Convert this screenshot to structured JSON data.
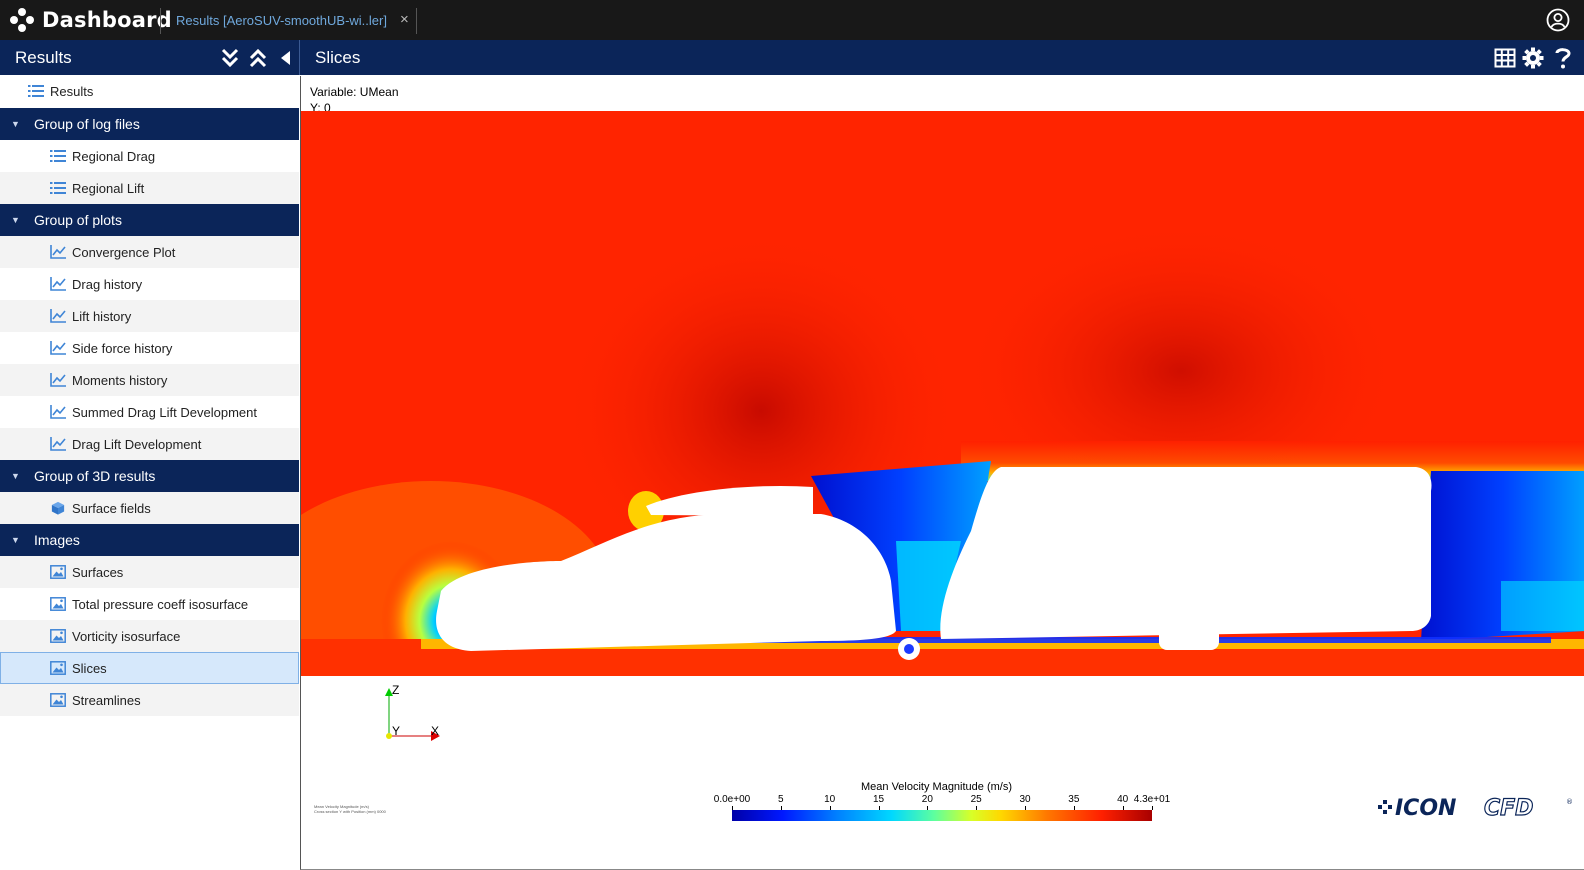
{
  "topbar": {
    "brand": "Dashboard",
    "tab_label": "Results [AeroSUV-smoothUB-wi..ler]",
    "tab_close": "×",
    "user_icon": "user-circle-icon"
  },
  "header": {
    "left_title": "Results",
    "main_title": "Slices",
    "left_icons": [
      "expand-all-icon",
      "collapse-all-icon",
      "collapse-panel-icon"
    ],
    "right_icons": [
      "table-icon",
      "gear-icon",
      "help-icon"
    ]
  },
  "sidebar": {
    "root": {
      "label": "Results",
      "icon": "list-icon"
    },
    "groups": [
      {
        "label": "Group of log files",
        "items": [
          {
            "label": "Regional Drag",
            "icon": "list-icon"
          },
          {
            "label": "Regional Lift",
            "icon": "list-icon"
          }
        ]
      },
      {
        "label": "Group of plots",
        "items": [
          {
            "label": "Convergence Plot",
            "icon": "line-chart-icon"
          },
          {
            "label": "Drag history",
            "icon": "line-chart-icon"
          },
          {
            "label": "Lift history",
            "icon": "line-chart-icon"
          },
          {
            "label": "Side force history",
            "icon": "line-chart-icon"
          },
          {
            "label": "Moments history",
            "icon": "line-chart-icon"
          },
          {
            "label": "Summed Drag Lift Development",
            "icon": "line-chart-icon"
          },
          {
            "label": "Drag Lift Development",
            "icon": "line-chart-icon"
          }
        ]
      },
      {
        "label": "Group of 3D results",
        "items": [
          {
            "label": "Surface fields",
            "icon": "cube-icon"
          }
        ]
      },
      {
        "label": "Images",
        "items": [
          {
            "label": "Surfaces",
            "icon": "image-icon"
          },
          {
            "label": "Total pressure coeff isosurface",
            "icon": "image-icon"
          },
          {
            "label": "Vorticity isosurface",
            "icon": "image-icon"
          },
          {
            "label": "Slices",
            "icon": "image-icon",
            "selected": true
          },
          {
            "label": "Streamlines",
            "icon": "image-icon"
          }
        ]
      }
    ]
  },
  "viewer": {
    "variable_line": "Variable: UMean",
    "position_line": "Y: 0",
    "axes": {
      "z": "Z",
      "y": "Y",
      "x": "X"
    },
    "colorbar": {
      "title": "Mean Velocity Magnitude (m/s)",
      "min": 0,
      "max": 43,
      "tick_labels": [
        "0.0e+00",
        "5",
        "10",
        "15",
        "20",
        "25",
        "30",
        "35",
        "40",
        "4.3e+01"
      ],
      "tick_values": [
        0,
        5,
        10,
        15,
        20,
        25,
        30,
        35,
        40,
        43
      ]
    },
    "caption_lines": [
      "Mean Velocity Magnitude (m/s)",
      "Cross section Y with Position (mm) 0000"
    ],
    "logo": "ICONCFD",
    "colors": {
      "freestream": "#ff2400",
      "wake": "#0a2cff",
      "body": "#ffffff"
    }
  }
}
